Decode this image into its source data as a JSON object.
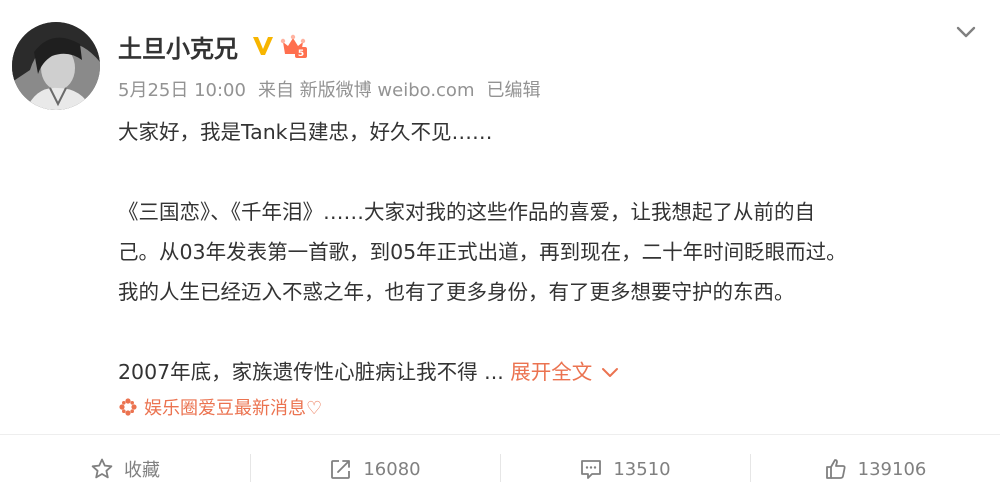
{
  "post": {
    "author": {
      "name": "土旦小克兄",
      "avatar_icon": "user-avatar",
      "verified_icon": "verified-v-icon",
      "badge_icon": "crown-level-5-icon",
      "badge_level": "5"
    },
    "meta": {
      "date": "5月25日 10:00",
      "source": "来自 新版微博 weibo.com",
      "edited": "已编辑"
    },
    "paragraphs": [
      [
        "大家好，我是Tank吕建忠，好久不见……"
      ],
      [
        "《三国恋》、《千年泪》……大家对我的这些作品的喜爱，让我想起了从前的自",
        "己。从03年发表第一首歌，到05年正式出道，再到现在，二十年时间眨眼而过。",
        "我的人生已经迈入不惑之年，也有了更多身份，有了更多想要守护的东西。"
      ]
    ],
    "truncated_line": "2007年底，家族遗传性心脏病让我不得 ...",
    "expand_label": "展开全文",
    "topic": "娱乐圈爱豆最新消息♡"
  },
  "actions": {
    "favorite": {
      "label": "收藏",
      "icon": "star-outline-icon"
    },
    "repost": {
      "count": "16080",
      "icon": "share-icon"
    },
    "comment": {
      "count": "13510",
      "icon": "comment-icon"
    },
    "like": {
      "count": "139106",
      "icon": "thumbs-up-icon"
    }
  },
  "colors": {
    "accent": "#eb7350",
    "meta_gray": "#939393",
    "text": "#333333",
    "verified": "#f7b500"
  }
}
